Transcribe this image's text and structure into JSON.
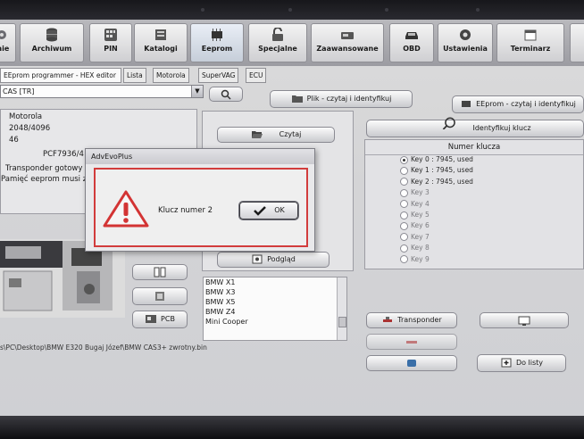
{
  "toolbar": {
    "items": [
      {
        "label": "mie",
        "icon": "gear-icon"
      },
      {
        "label": "Archiwum",
        "icon": "database-icon"
      },
      {
        "label": "PIN",
        "icon": "keypad-icon"
      },
      {
        "label": "Katalogi",
        "icon": "catalog-icon"
      },
      {
        "label": "Eeprom",
        "icon": "chip-icon"
      },
      {
        "label": "Specjalne",
        "icon": "padlock-icon"
      },
      {
        "label": "Zaawansowane",
        "icon": "device-icon"
      },
      {
        "label": "OBD",
        "icon": "car-icon"
      },
      {
        "label": "Ustawienia",
        "icon": "settings-icon"
      },
      {
        "label": "Terminarz",
        "icon": "calendar-icon"
      }
    ]
  },
  "tabs": [
    "EEprom programmer - HEX editor",
    "Lista",
    "Motorola",
    "SuperVAG",
    "ECU"
  ],
  "combo": {
    "value": "CAS  [TR]"
  },
  "buttons": {
    "read_file": "Plik - czytaj i identyfikuj",
    "read_eeprom": "EEprom - czytaj i identyfikuj",
    "read": "Czytaj",
    "identify_key": "Identyfikuj klucz",
    "preview": "Podgląd",
    "pcb": "PCB",
    "transponder": "Transponder",
    "to_list": "Do listy"
  },
  "info": {
    "line1": "Motorola",
    "line2": "2048/4096",
    "line3": "46",
    "line4": "PCF7936/4",
    "line5": "Transponder gotowy",
    "line6": "Pamięć eeprom musi z"
  },
  "keys_panel": {
    "header": "Numer klucza",
    "keys": [
      {
        "label": "Key 0 : 7945, used",
        "selected": true
      },
      {
        "label": "Key 1 : 7945, used",
        "selected": false
      },
      {
        "label": "Key 2 : 7945, used",
        "selected": false
      },
      {
        "label": "Key 3",
        "selected": false
      },
      {
        "label": "Key 4",
        "selected": false
      },
      {
        "label": "Key 5",
        "selected": false
      },
      {
        "label": "Key 6",
        "selected": false
      },
      {
        "label": "Key 7",
        "selected": false
      },
      {
        "label": "Key 8",
        "selected": false
      },
      {
        "label": "Key 9",
        "selected": false
      }
    ]
  },
  "models": [
    "BMW X1",
    "BMW X3",
    "BMW X5",
    "BMW Z4",
    "Mini Cooper"
  ],
  "path": "s\\PC\\Desktop\\BMW E320 Bugaj Józef\\BMW CAS3+ zwrotny.bin",
  "dialog": {
    "title": "AdvEvoPlus",
    "message": "Klucz numer  2",
    "ok": "OK"
  },
  "colors": {
    "dialog_border": "#d23c3c",
    "warning_icon": "#d33434"
  }
}
